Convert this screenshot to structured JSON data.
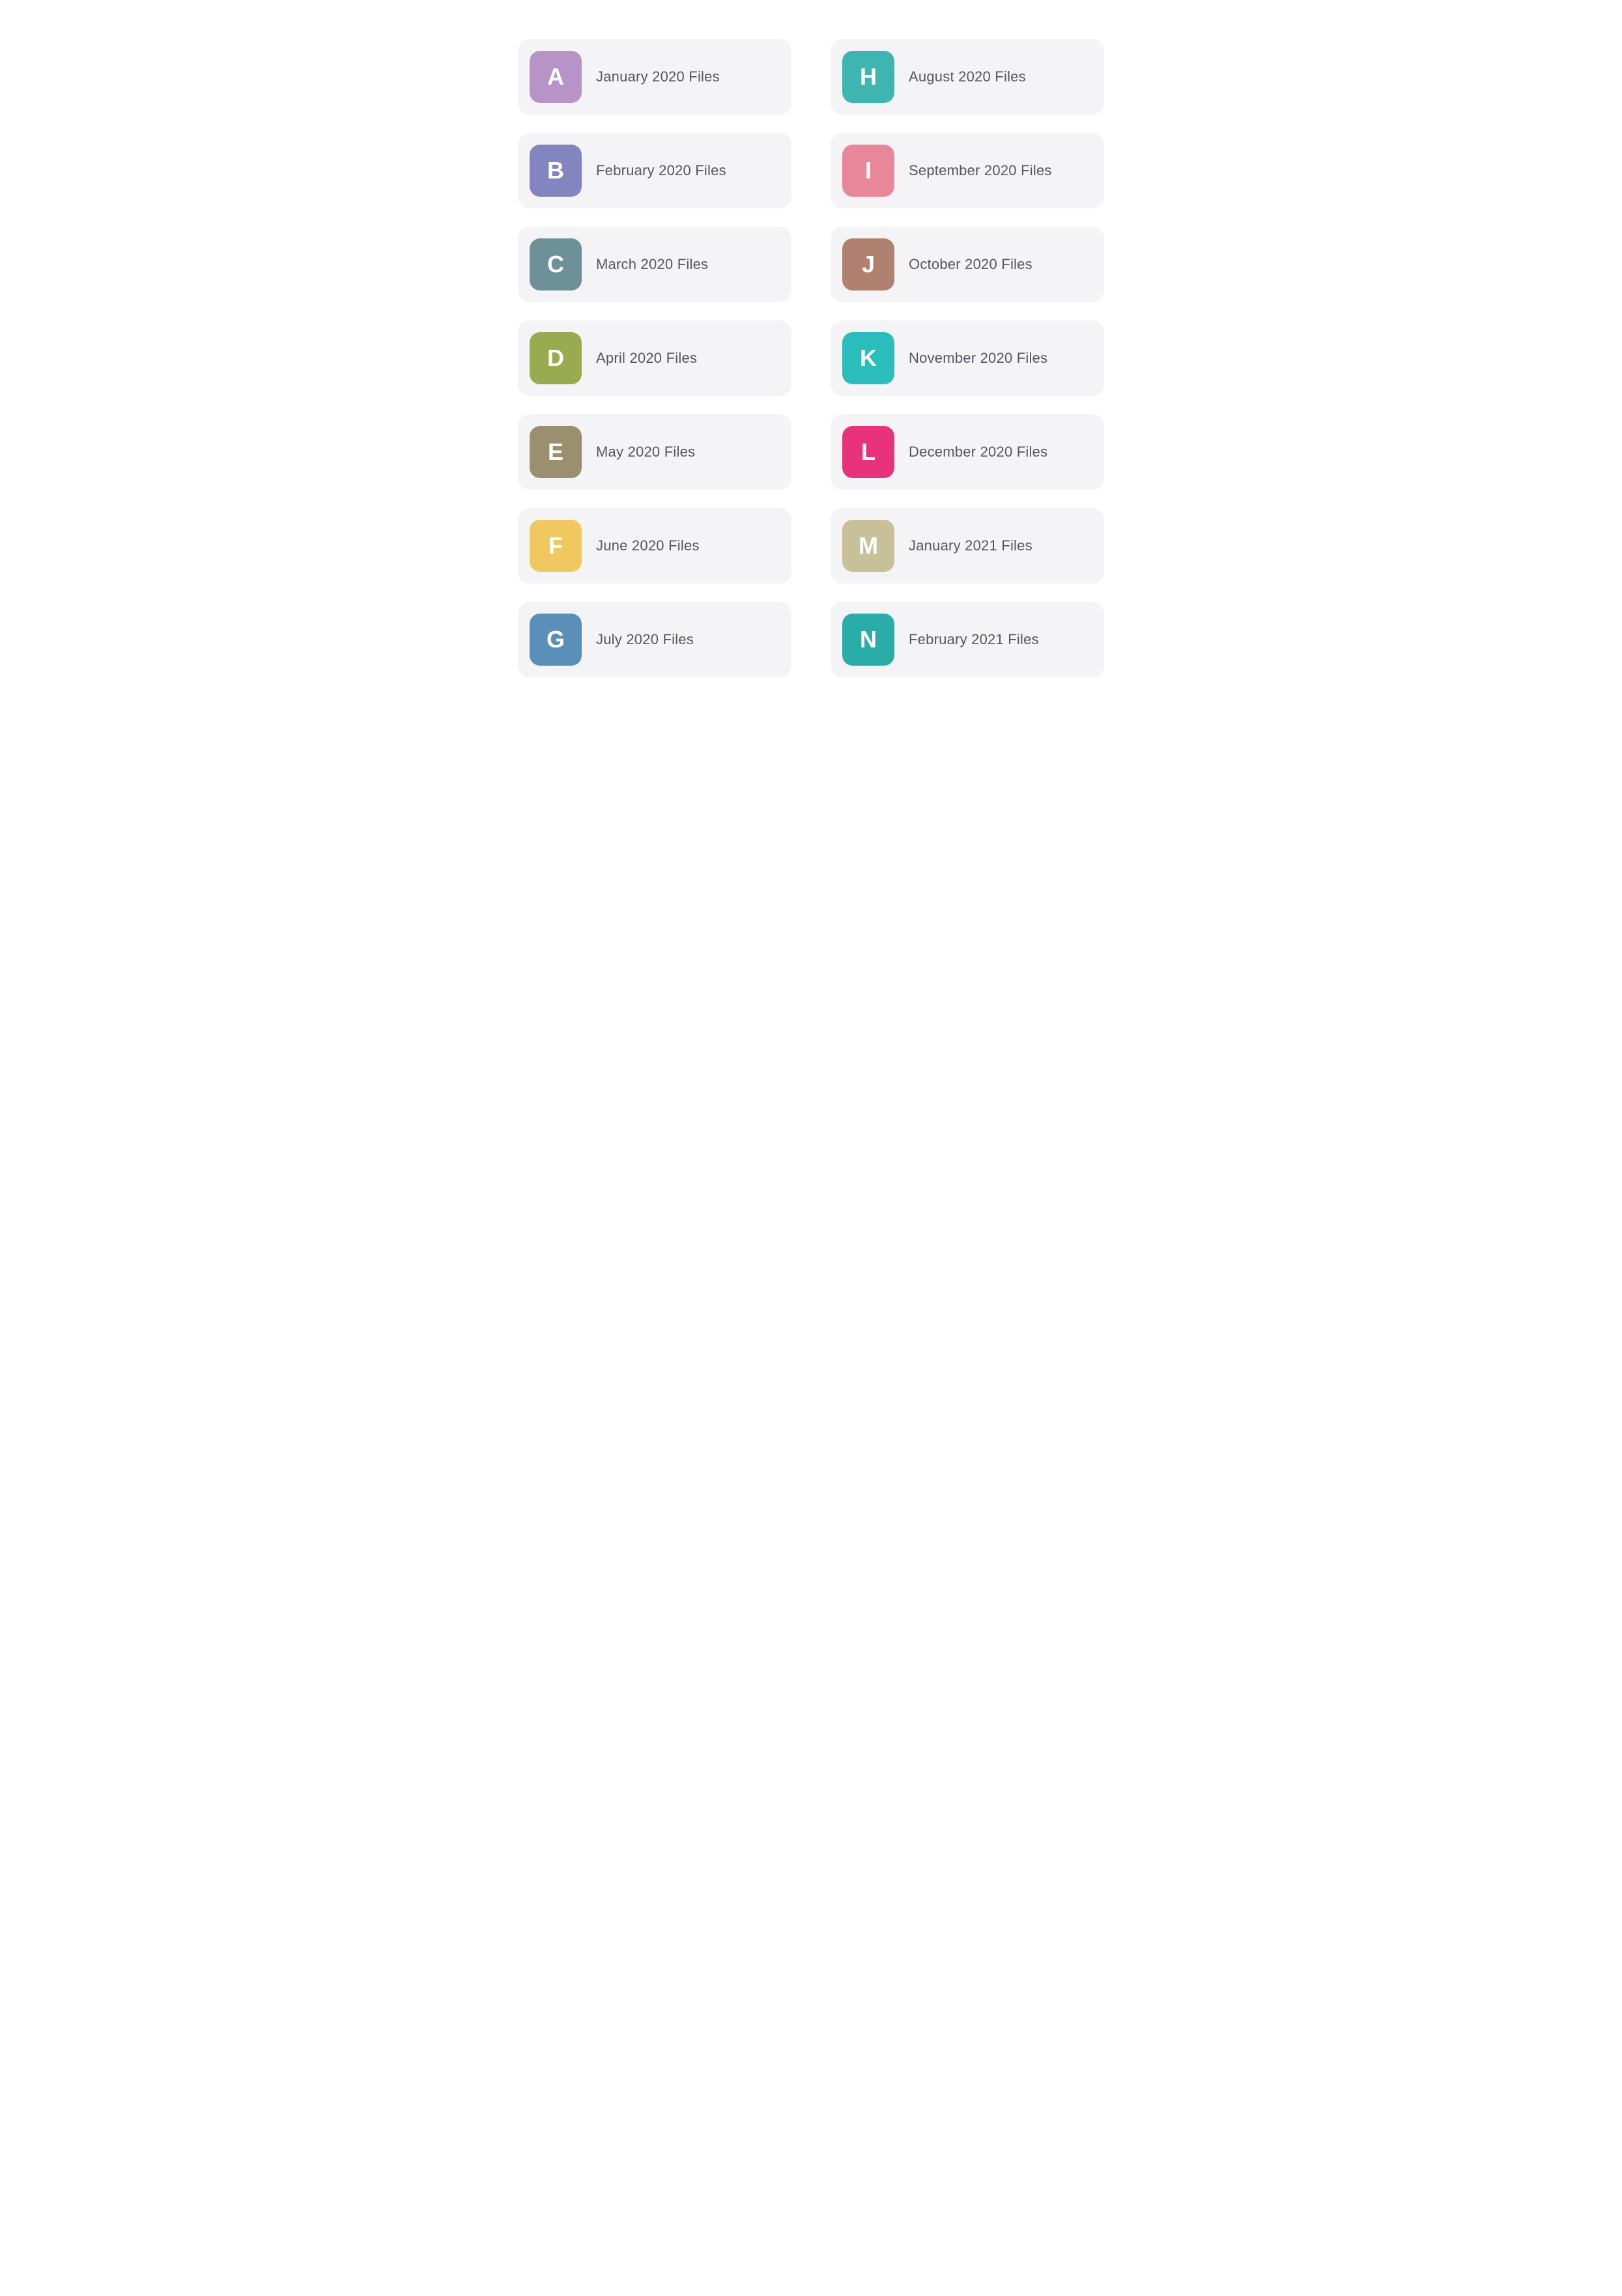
{
  "folders": [
    {
      "id": "a",
      "letter": "A",
      "label": "January 2020 Files",
      "color": "#b893c8"
    },
    {
      "id": "h",
      "letter": "H",
      "label": "August 2020 Files",
      "color": "#3eb5b0"
    },
    {
      "id": "b",
      "letter": "B",
      "label": "February 2020 Files",
      "color": "#8285c0"
    },
    {
      "id": "i",
      "letter": "I",
      "label": "September 2020 Files",
      "color": "#e8879a"
    },
    {
      "id": "c",
      "letter": "C",
      "label": "March 2020 Files",
      "color": "#6e9098"
    },
    {
      "id": "j",
      "letter": "J",
      "label": "October 2020 Files",
      "color": "#b08070"
    },
    {
      "id": "d",
      "letter": "D",
      "label": "April 2020 Files",
      "color": "#9aaa50"
    },
    {
      "id": "k",
      "letter": "K",
      "label": "November 2020 Files",
      "color": "#2bbcbc"
    },
    {
      "id": "e",
      "letter": "E",
      "label": "May 2020 Files",
      "color": "#9a9070"
    },
    {
      "id": "l",
      "letter": "L",
      "label": "December 2020 Files",
      "color": "#e8337a"
    },
    {
      "id": "f",
      "letter": "F",
      "label": "June 2020 Files",
      "color": "#f0c860"
    },
    {
      "id": "m",
      "letter": "M",
      "label": "January 2021 Files",
      "color": "#c8c098"
    },
    {
      "id": "g",
      "letter": "G",
      "label": "July 2020 Files",
      "color": "#5a90b8"
    },
    {
      "id": "n",
      "letter": "N",
      "label": "February 2021 Files",
      "color": "#2aaca8"
    }
  ]
}
